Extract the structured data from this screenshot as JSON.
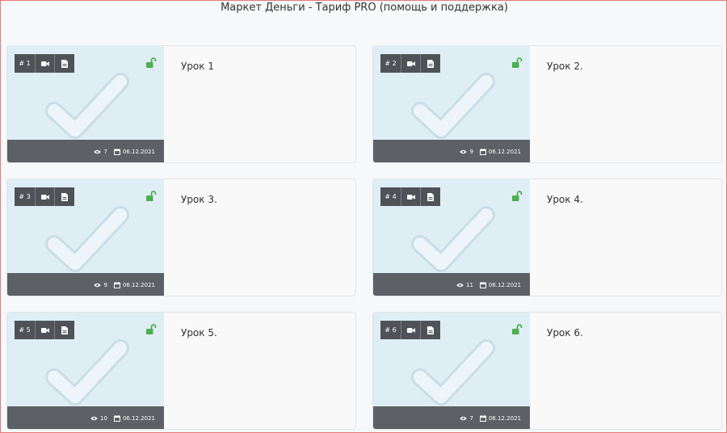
{
  "page": {
    "title": "Маркет Деньги - Тариф PRO (помощь и поддержка)"
  },
  "colors": {
    "accent_lock": "#4caf50",
    "thumb_bg": "#dfeef5",
    "footer_bg": "#5d6165"
  },
  "lessons": [
    {
      "num": "# 1",
      "title": "Урок 1",
      "views": "7",
      "date": "06.12.2021"
    },
    {
      "num": "# 2",
      "title": "Урок 2.",
      "views": "9",
      "date": "06.12.2021"
    },
    {
      "num": "# 3",
      "title": "Урок 3.",
      "views": "9",
      "date": "06.12.2021"
    },
    {
      "num": "# 4",
      "title": "Урок 4.",
      "views": "11",
      "date": "06.12.2021"
    },
    {
      "num": "# 5",
      "title": "Урок 5.",
      "views": "10",
      "date": "06.12.2021"
    },
    {
      "num": "# 6",
      "title": "Урок 6.",
      "views": "7",
      "date": "06.12.2021"
    }
  ]
}
